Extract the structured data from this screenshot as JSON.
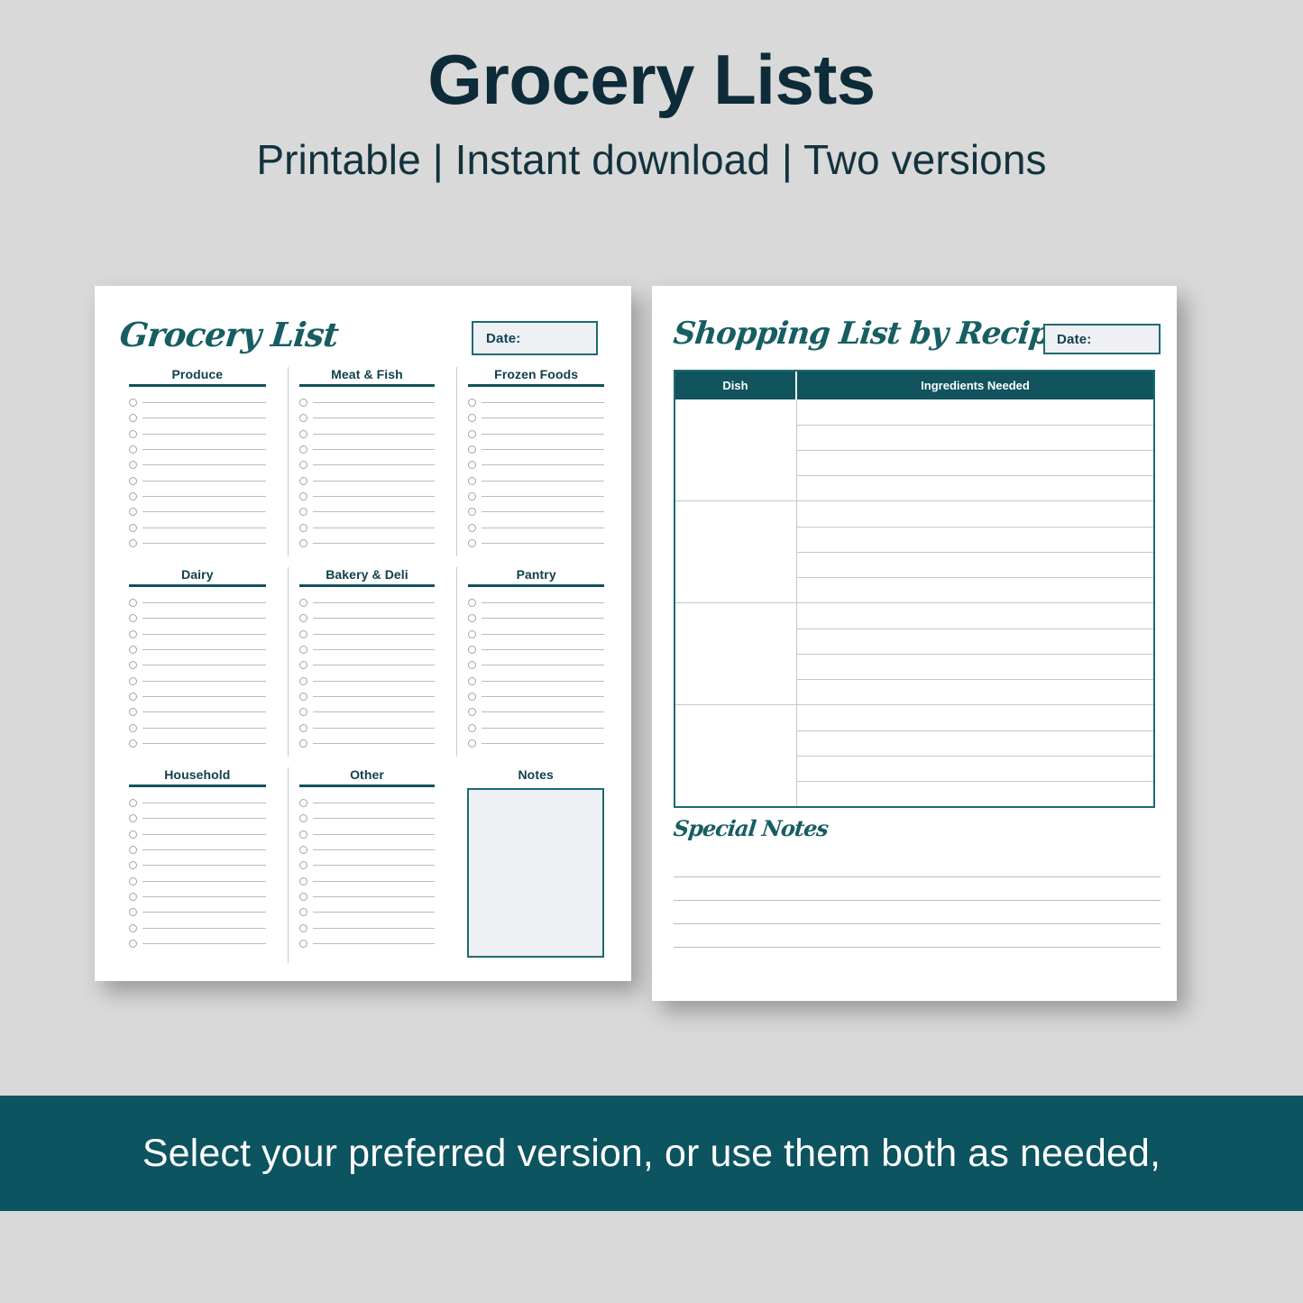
{
  "header": {
    "title": "Grocery Lists",
    "subtitle": "Printable | Instant download | Two versions"
  },
  "colors": {
    "background": "#d9d9d9",
    "title_navy": "#0d2b38",
    "teal": "#11545e",
    "teal_border": "#1c6b72",
    "script_teal": "#175e63",
    "box_fill": "#eef0f4",
    "rule_gray": "#b9bcc1",
    "banner": "#0c545f"
  },
  "left_page": {
    "name": "grocery-list-page",
    "title": "Grocery List",
    "date_label": "Date:",
    "rows_per_section": 10,
    "sections": [
      {
        "label": "Produce",
        "type": "checklist",
        "rows": 10
      },
      {
        "label": "Meat & Fish",
        "type": "checklist",
        "rows": 10
      },
      {
        "label": "Frozen Foods",
        "type": "checklist",
        "rows": 10
      },
      {
        "label": "Dairy",
        "type": "checklist",
        "rows": 10
      },
      {
        "label": "Bakery & Deli",
        "type": "checklist",
        "rows": 10
      },
      {
        "label": "Pantry",
        "type": "checklist",
        "rows": 10
      },
      {
        "label": "Household",
        "type": "checklist",
        "rows": 10
      },
      {
        "label": "Other",
        "type": "checklist",
        "rows": 10
      },
      {
        "label": "Notes",
        "type": "textbox",
        "rows": 0
      }
    ]
  },
  "right_page": {
    "name": "shopping-list-by-recipe-page",
    "title": "Shopping List by Recipe",
    "date_label": "Date:",
    "table": {
      "columns": [
        "Dish",
        "Ingredients Needed"
      ],
      "dish_blocks": 4,
      "ingredient_rows_per_block": 4,
      "dishes": [
        "",
        "",
        "",
        ""
      ],
      "ingredients": [
        [
          "",
          "",
          "",
          ""
        ],
        [
          "",
          "",
          "",
          ""
        ],
        [
          "",
          "",
          "",
          ""
        ],
        [
          "",
          "",
          "",
          ""
        ]
      ]
    },
    "special_notes": {
      "title": "Special Notes",
      "lines": 4
    }
  },
  "banner": {
    "text": "Select your preferred version, or use them both as needed,"
  }
}
